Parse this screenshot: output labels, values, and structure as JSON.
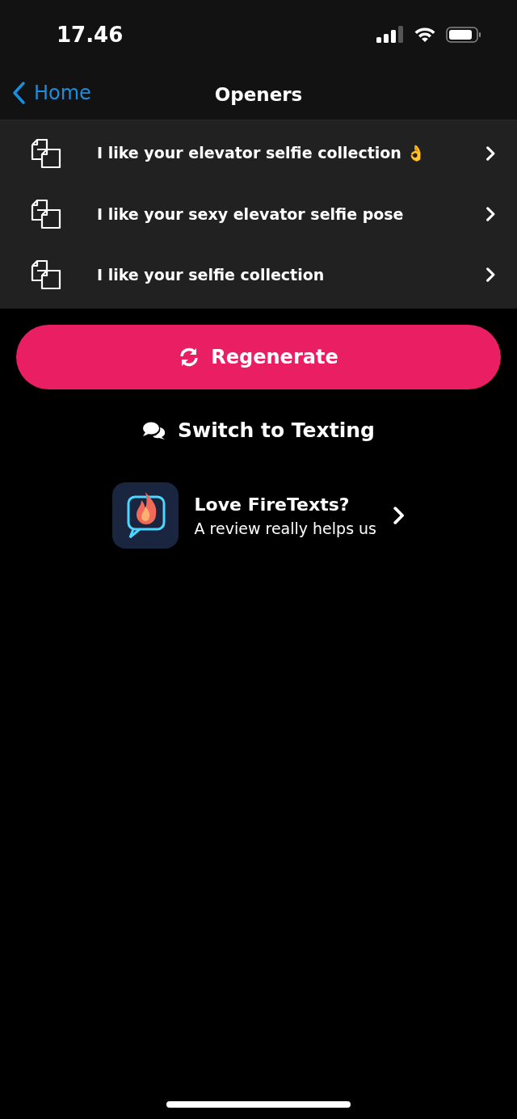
{
  "status_bar": {
    "time": "17.46"
  },
  "nav": {
    "back": "Home",
    "title": "Openers"
  },
  "openers": [
    {
      "text": "I like your elevator selfie collection 👌"
    },
    {
      "text": "I like your sexy elevator selfie pose"
    },
    {
      "text": "I like your selfie collection"
    }
  ],
  "regenerate_button": "Regenerate",
  "switch_link": "Switch to Texting",
  "review": {
    "title": "Love FireTexts?",
    "subtitle": "A review really helps us"
  }
}
